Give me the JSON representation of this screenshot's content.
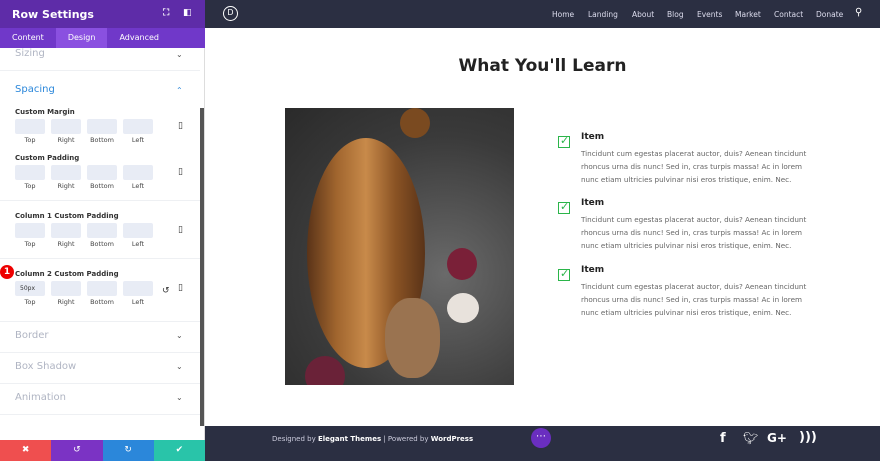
{
  "panel": {
    "title": "Row Settings",
    "tabs": [
      "Content",
      "Design",
      "Advanced"
    ],
    "sections": {
      "sizing": "Sizing",
      "spacing": "Spacing",
      "border": "Border",
      "box_shadow": "Box Shadow",
      "animation": "Animation"
    },
    "groups": [
      {
        "label": "Custom Margin",
        "values": [
          "",
          "",
          "",
          ""
        ]
      },
      {
        "label": "Custom Padding",
        "values": [
          "",
          "",
          "",
          ""
        ]
      },
      {
        "label": "Column 1 Custom Padding",
        "values": [
          "",
          "",
          "",
          ""
        ]
      },
      {
        "label": "Column 2 Custom Padding",
        "values": [
          "50px",
          "",
          "",
          ""
        ]
      }
    ],
    "sides": [
      "Top",
      "Right",
      "Bottom",
      "Left"
    ],
    "badge": "1"
  },
  "nav": {
    "logo": "D",
    "items": [
      "Home",
      "Landing",
      "About",
      "Blog",
      "Events",
      "Market",
      "Contact",
      "Donate"
    ]
  },
  "main": {
    "title": "What You'll Learn",
    "items": [
      {
        "title": "Item",
        "desc": "Tincidunt cum egestas placerat auctor, duis? Aenean tincidunt rhoncus urna dis nunc! Sed in, cras turpis massa! Ac in lorem nunc etiam ultricies pulvinar nisi eros tristique, enim. Nec."
      },
      {
        "title": "Item",
        "desc": "Tincidunt cum egestas placerat auctor, duis? Aenean tincidunt rhoncus urna dis nunc! Sed in, cras turpis massa! Ac in lorem nunc etiam ultricies pulvinar nisi eros tristique, enim. Nec."
      },
      {
        "title": "Item",
        "desc": "Tincidunt cum egestas placerat auctor, duis? Aenean tincidunt rhoncus urna dis nunc! Sed in, cras turpis massa! Ac in lorem nunc etiam ultricies pulvinar nisi eros tristique, enim. Nec."
      }
    ]
  },
  "footer": {
    "designed": "Designed by ",
    "et": "Elegant Themes",
    "powered": " | Powered by ",
    "wp": "WordPress",
    "social": [
      "f",
      "t",
      "G+",
      "rss"
    ]
  },
  "colors": {
    "purple": "#5e2ca8",
    "red": "#ef4f4f",
    "blue": "#2b87da",
    "teal": "#29c4a9",
    "nav": "#2b2f42"
  }
}
